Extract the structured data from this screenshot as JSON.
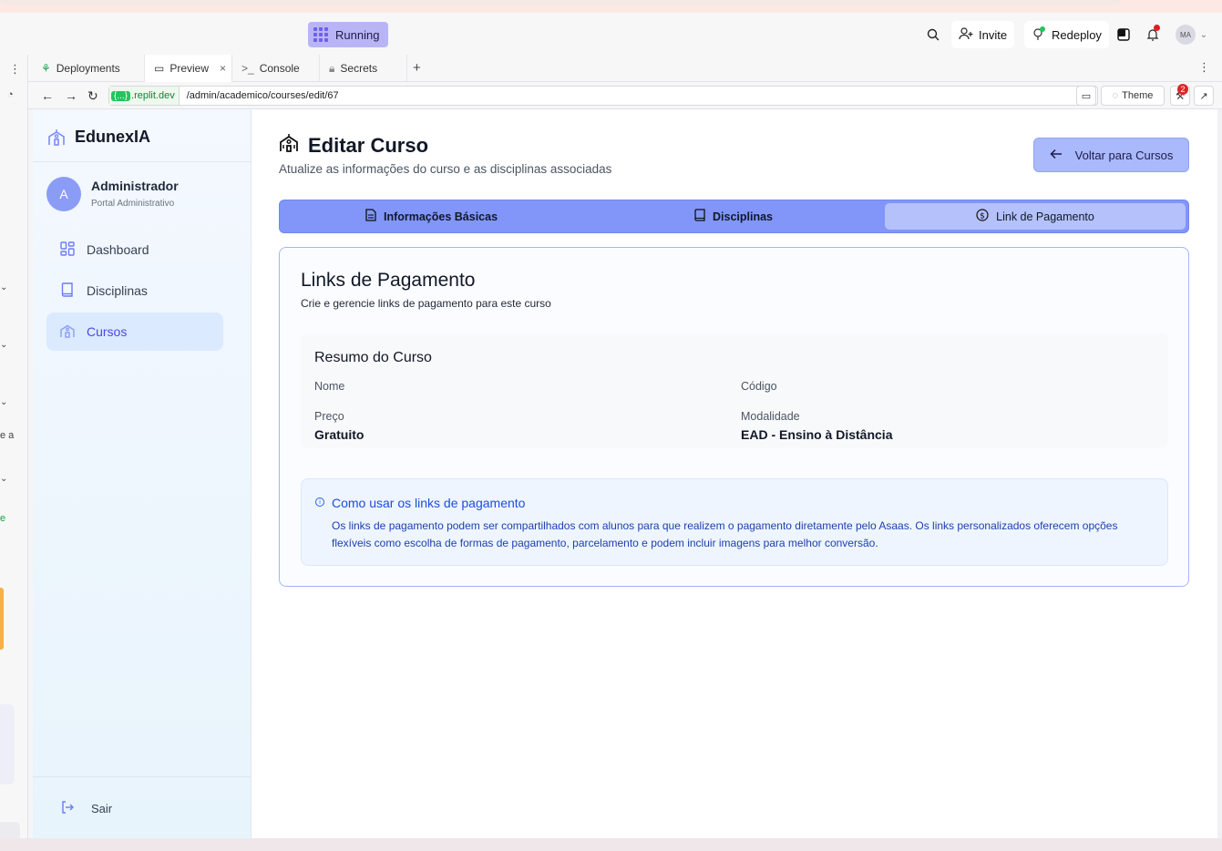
{
  "replit": {
    "status_label": "Running",
    "invite_label": "Invite",
    "redeploy_label": "Redeploy",
    "avatar_initials": "MA",
    "tabs": [
      {
        "label": "Deployments"
      },
      {
        "label": "Preview"
      },
      {
        "label": "Console"
      },
      {
        "label": "Secrets"
      }
    ],
    "url_host_pill": "{...}",
    "url_host": ".replit.dev",
    "url_path": "/admin/academico/courses/edit/67",
    "theme_label": "Theme",
    "notification_count": "2",
    "left_snippets": [
      "e a",
      "e"
    ]
  },
  "sidebar": {
    "brand": "EdunexIA",
    "user_initial": "A",
    "user_name": "Administrador",
    "user_role": "Portal Administrativo",
    "items": [
      {
        "label": "Dashboard",
        "icon": "dashboard-icon"
      },
      {
        "label": "Disciplinas",
        "icon": "book-icon"
      },
      {
        "label": "Cursos",
        "icon": "school-icon"
      }
    ],
    "logout_label": "Sair"
  },
  "main": {
    "title": "Editar Curso",
    "subtitle": "Atualize as informações do curso e as disciplinas associadas",
    "back_button": "Voltar para Cursos",
    "tabs": [
      {
        "label": "Informações Básicas",
        "icon": "document-icon"
      },
      {
        "label": "Disciplinas",
        "icon": "book-icon"
      },
      {
        "label": "Link de Pagamento",
        "icon": "dollar-circle-icon"
      }
    ],
    "active_tab": "Link de Pagamento",
    "card": {
      "title": "Links de Pagamento",
      "subtitle": "Crie e gerencie links de pagamento para este curso",
      "summary": {
        "title": "Resumo do Curso",
        "name_label": "Nome",
        "name_value": "",
        "code_label": "Código",
        "code_value": "",
        "price_label": "Preço",
        "price_value": "Gratuito",
        "modality_label": "Modalidade",
        "modality_value": "EAD - Ensino à Distância"
      },
      "info": {
        "title": "Como usar os links de pagamento",
        "text": "Os links de pagamento podem ser compartilhados com alunos para que realizem o pagamento diretamente pelo Asaas. Os links personalizados oferecem opções flexíveis como escolha de formas de pagamento, parcelamento e podem incluir imagens para melhor conversão."
      }
    }
  },
  "colors": {
    "accent": "#8196f8",
    "active_nav_bg": "#dbeafe",
    "active_nav_text": "#4f46e5",
    "info_text": "#1e40af"
  }
}
